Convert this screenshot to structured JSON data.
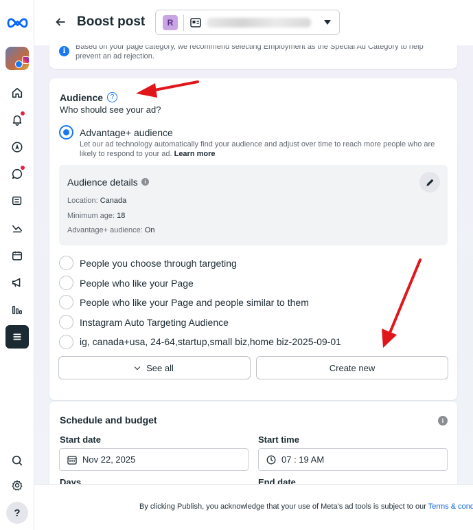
{
  "header": {
    "title": "Boost post",
    "page_initial": "R"
  },
  "info": {
    "text": "Based on your page category, we recommend selecting Employment as the Special Ad Category to help prevent an ad rejection."
  },
  "audience": {
    "title": "Audience",
    "subtitle": "Who should see your ad?",
    "advantage_label": "Advantage+ audience",
    "advantage_desc": "Let our ad technology automatically find your audience and adjust over time to reach more people who are likely to respond to your ad.",
    "learn_more": "Learn more",
    "details": {
      "title": "Audience details",
      "location_label": "Location:",
      "location_value": "Canada",
      "min_age_label": "Minimum age:",
      "min_age_value": "18",
      "adv_label": "Advantage+ audience:",
      "adv_value": "On"
    },
    "options": [
      "People you choose through targeting",
      "People who like your Page",
      "People who like your Page and people similar to them",
      "Instagram Auto Targeting Audience",
      "ig, canada+usa, 24-64,startup,small biz,home biz-2025-09-01"
    ],
    "see_all": "See all",
    "create_new": "Create new"
  },
  "schedule": {
    "title": "Schedule and budget",
    "start_date_label": "Start date",
    "start_date": "Nov 22, 2025",
    "start_time_label": "Start time",
    "start_time": "07 : 19 AM",
    "days_label": "Days",
    "end_date_label": "End date"
  },
  "footer": {
    "text": "By clicking Publish, you acknowledge that your use of Meta's ad tools is subject to our ",
    "link": "Terms & cond"
  },
  "colors": {
    "accent": "#1877f2",
    "annotation_arrow": "#e0161b"
  }
}
